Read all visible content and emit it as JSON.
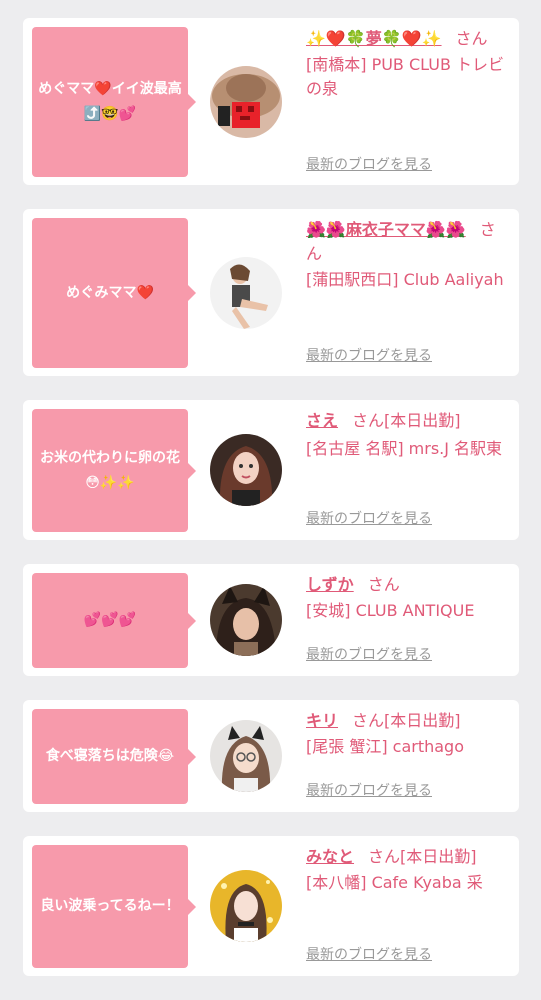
{
  "entries": [
    {
      "message": "めぐママ❤️イイ波最高⤴️🤓💕",
      "name": "✨❤️🍀夢🍀❤️✨",
      "suffix": "さん",
      "shop": "[南橋本] PUB CLUB トレビの泉",
      "blog_link": "最新のブログを見る"
    },
    {
      "message": "めぐみママ❤️",
      "name": "🌺🌺麻衣子ママ🌺🌺",
      "suffix": "さん",
      "shop": "[蒲田駅西口] Club Aaliyah",
      "blog_link": "最新のブログを見る"
    },
    {
      "message": "お米の代わりに卵の花😳✨✨",
      "name": "さえ",
      "suffix": "さん[本日出勤]",
      "shop": "[名古屋 名駅] mrs.J 名駅東",
      "blog_link": "最新のブログを見る"
    },
    {
      "message": "💕💕💕",
      "name": "しずか",
      "suffix": "さん",
      "shop": "[安城] CLUB ANTIQUE",
      "blog_link": "最新のブログを見る"
    },
    {
      "message": "食べ寝落ちは危険😂",
      "name": "キリ",
      "suffix": "さん[本日出勤]",
      "shop": "[尾張 蟹江] carthago",
      "blog_link": "最新のブログを見る"
    },
    {
      "message": "良い波乗ってるねー！",
      "name": "みなと",
      "suffix": "さん[本日出勤]",
      "shop": "[本八幡] Cafe Kyaba 采",
      "blog_link": "最新のブログを見る"
    }
  ]
}
